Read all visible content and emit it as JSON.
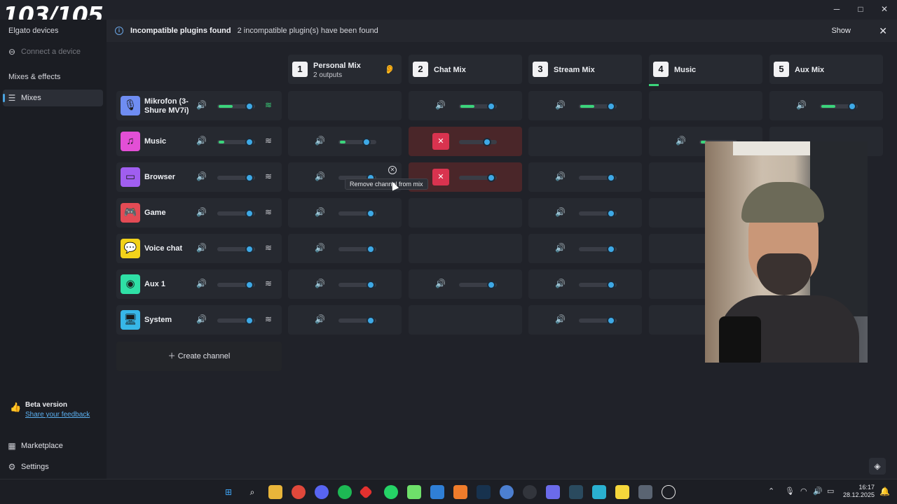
{
  "overlay_counter": "103/105",
  "window": {
    "minimize": "─",
    "maximize": "□",
    "close": "✕"
  },
  "sidebar": {
    "devices_heading": "Elgato devices",
    "connect_device": "Connect a device",
    "mixes_heading": "Mixes & effects",
    "mixes_item": "Mixes",
    "beta_title": "Beta version",
    "feedback_link": "Share your feedback",
    "marketplace": "Marketplace",
    "settings": "Settings"
  },
  "notification": {
    "title": "Incompatible plugins found",
    "message": "2 incompatible plugin(s) have been found",
    "show_label": "Show",
    "close_label": "✕"
  },
  "mixes": [
    {
      "num": "1",
      "name": "Personal Mix",
      "sub": "2 outputs"
    },
    {
      "num": "2",
      "name": "Chat Mix",
      "sub": ""
    },
    {
      "num": "3",
      "name": "Stream Mix",
      "sub": ""
    },
    {
      "num": "4",
      "name": "Music",
      "sub": ""
    },
    {
      "num": "5",
      "name": "Aux Mix",
      "sub": ""
    }
  ],
  "channels": [
    {
      "name": "Mikrofon (3-\nShure MV7i)",
      "icon": "🎙",
      "color": "#6f8df2"
    },
    {
      "name": "Music",
      "icon": "♫",
      "color": "#e34fd6"
    },
    {
      "name": "Browser",
      "icon": "▭",
      "color": "#a05ef0"
    },
    {
      "name": "Game",
      "icon": "🎮",
      "color": "#e34b55"
    },
    {
      "name": "Voice chat",
      "icon": "💬",
      "color": "#f2d21b"
    },
    {
      "name": "Aux 1",
      "icon": "◉",
      "color": "#2fe0a6"
    },
    {
      "name": "System",
      "icon": "🖥",
      "color": "#37b7e8"
    }
  ],
  "create_channel": "Create channel",
  "tooltip": "Remove channel from mix",
  "icons": {
    "volume": "🔊",
    "waveform": "≋",
    "mute": "✕",
    "ear": "👂"
  },
  "colors": {
    "accent": "#3ea9e6",
    "meter": "#3bd47b",
    "mute": "#d9334f"
  },
  "taskbar": {
    "time": "16:17",
    "date": "28.12.2025"
  }
}
